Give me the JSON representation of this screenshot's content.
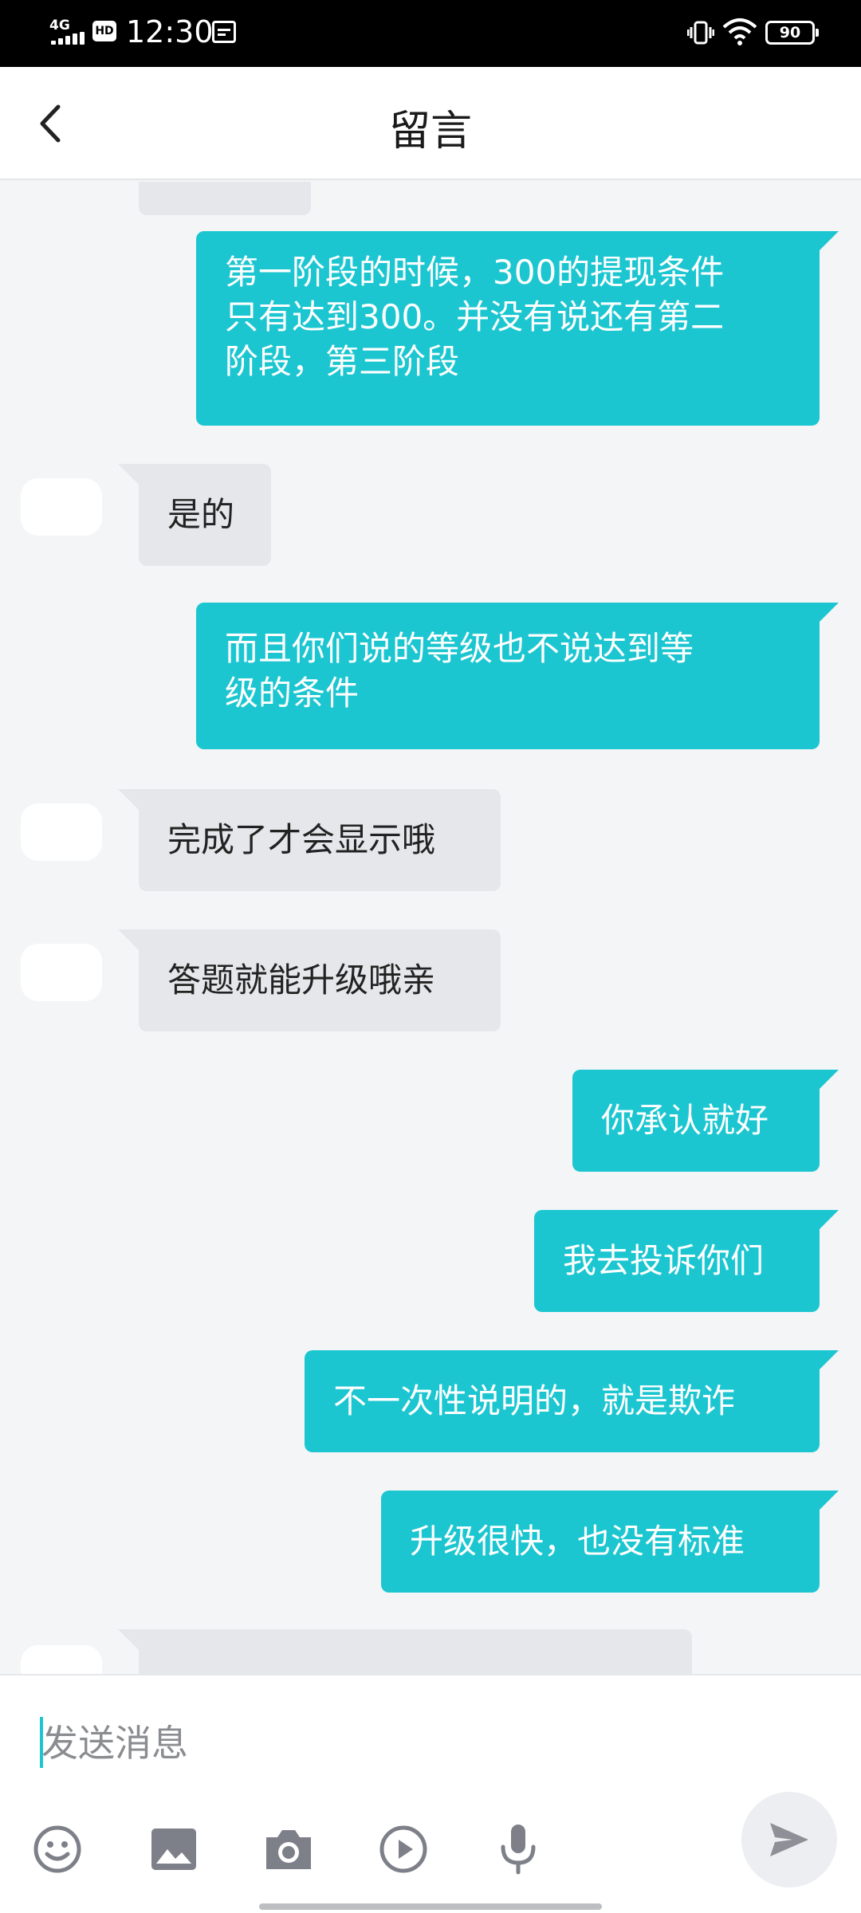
{
  "status_bar": {
    "network": "4G",
    "hd": "HD",
    "time": "12:30",
    "battery": "90"
  },
  "header": {
    "title": "留言",
    "back_icon": "chevron-left-icon"
  },
  "messages": [
    {
      "side": "sent",
      "text": "第一阶段的时候，300的提现条件只有达到300。并没有说还有第二阶段，第三阶段",
      "lines": [
        "第一阶段的时候，300的提现条件",
        "只有达到300。并没有说还有第二",
        "阶段，第三阶段"
      ]
    },
    {
      "side": "recv",
      "text": "是的"
    },
    {
      "side": "sent",
      "text": "而且你们说的等级也不说达到等级的条件",
      "lines": [
        "而且你们说的等级也不说达到等",
        "级的条件"
      ]
    },
    {
      "side": "recv",
      "text": "完成了才会显示哦"
    },
    {
      "side": "recv",
      "text": "答题就能升级哦亲"
    },
    {
      "side": "sent",
      "text": "你承认就好"
    },
    {
      "side": "sent",
      "text": "我去投诉你们"
    },
    {
      "side": "sent",
      "text": "不一次性说明的，就是欺诈"
    },
    {
      "side": "sent",
      "text": "升级很快，也没有标准"
    }
  ],
  "composer": {
    "placeholder": "发送消息",
    "tools": [
      "emoji-icon",
      "image-icon",
      "camera-icon",
      "video-icon",
      "microphone-icon"
    ],
    "send_icon": "send-icon"
  },
  "colors": {
    "sent_bubble": "#1cc6d1",
    "recv_bubble": "#e6e7ea",
    "background": "#f4f5f7"
  }
}
